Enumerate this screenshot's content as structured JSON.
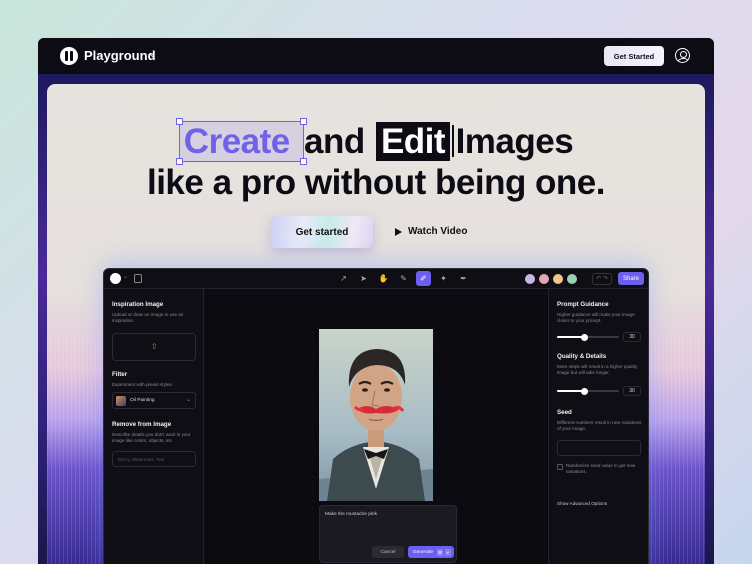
{
  "topbar": {
    "brand": "Playground",
    "cta": "Get Started"
  },
  "hero": {
    "headline_word1": "Create",
    "headline_word2": "and",
    "headline_word3": "Edit",
    "headline_word4": "Images",
    "headline_line2": "like a pro without being one.",
    "primary_button": "Get started",
    "secondary_button": "Watch Video"
  },
  "app": {
    "share_label": "Share",
    "left_panel": {
      "inspiration_title": "Inspiration Image",
      "inspiration_desc": "Upload or draw an image to use as inspiration.",
      "filter_title": "Filter",
      "filter_desc": "Experiment with preset styles.",
      "filter_value": "Oil Painting",
      "remove_title": "Remove from Image",
      "remove_desc": "Describe details you don't want in your image like colors, objects, etc.",
      "remove_placeholder": "Blurry, Watermark, Text"
    },
    "right_panel": {
      "prompt_guidance_title": "Prompt Guidance",
      "prompt_guidance_desc": "Higher guidance will make your image closer to your prompt.",
      "prompt_guidance_value": "30",
      "prompt_guidance_level": 0.44,
      "quality_title": "Quality & Details",
      "quality_desc": "More steps will result in a higher quality image but will take longer.",
      "quality_value": "30",
      "quality_level": 0.44,
      "seed_title": "Seed",
      "seed_desc": "Different numbers result in new variations of your image.",
      "randomize_label": "Randomize seed value to get new variations.",
      "advanced_label": "Show Advanced Options"
    },
    "prompt": {
      "text": "Make the mustache pink",
      "cancel": "Cancel",
      "generate": "Generate"
    }
  },
  "colors": {
    "accent": "#6d5ff0",
    "highlight_word": "#6f62e8",
    "dark": "#0d0b14"
  }
}
